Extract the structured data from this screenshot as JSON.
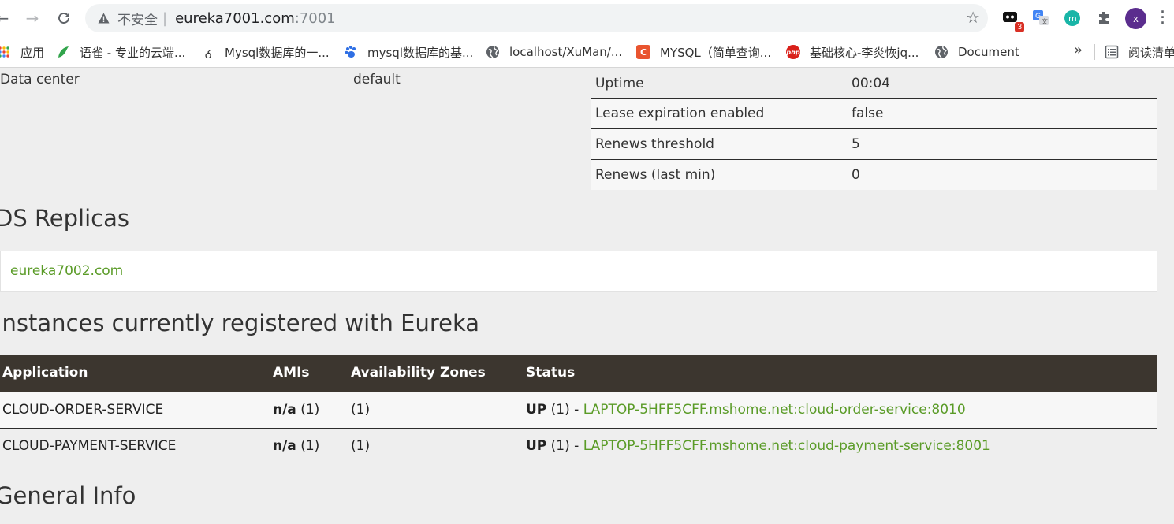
{
  "browser": {
    "insecure_label": "不安全",
    "url_host": "eureka7001.com",
    "url_port": ":7001",
    "extension_badge": "3",
    "profile_initial": "x",
    "bookmarks": [
      {
        "label": "应用",
        "icon": "apps-grid-icon"
      },
      {
        "label": "语雀 - 专业的云端...",
        "icon": "yuque-bird-icon",
        "color": "#31a44b"
      },
      {
        "label": "Mysql数据库的一...",
        "icon": "script-icon"
      },
      {
        "label": "mysql数据库的基...",
        "icon": "baidu-paw-icon",
        "color": "#2f6fe4"
      },
      {
        "label": "localhost/XuMan/...",
        "icon": "globe-icon"
      },
      {
        "label": "MYSQL（简单查询...",
        "icon": "csdn-c-icon",
        "color": "#e9542f"
      },
      {
        "label": "基础核心-李炎恢jq...",
        "icon": "php-icon",
        "color": "#d9201a"
      },
      {
        "label": "Document",
        "icon": "globe-icon"
      }
    ],
    "more_label": "»",
    "reading_list_label": "阅读清单"
  },
  "info": {
    "left_label": "Data center",
    "left_value": "default",
    "status_rows": [
      {
        "key": "Uptime",
        "value": "00:04"
      },
      {
        "key": "Lease expiration enabled",
        "value": "false"
      },
      {
        "key": "Renews threshold",
        "value": "5"
      },
      {
        "key": "Renews (last min)",
        "value": "0"
      }
    ]
  },
  "replicas": {
    "heading": "DS Replicas",
    "items": [
      "eureka7002.com"
    ]
  },
  "instances": {
    "heading": "Instances currently registered with Eureka",
    "columns": [
      "Application",
      "AMIs",
      "Availability Zones",
      "Status"
    ],
    "rows": [
      {
        "application": "CLOUD-ORDER-SERVICE",
        "amis_bold": "n/a",
        "amis_count": " (1)",
        "zones": "(1)",
        "status_prefix": "UP",
        "status_count": " (1) - ",
        "instance_link": "LAPTOP-5HFF5CFF.mshome.net:cloud-order-service:8010"
      },
      {
        "application": "CLOUD-PAYMENT-SERVICE",
        "amis_bold": "n/a",
        "amis_count": " (1)",
        "zones": "(1)",
        "status_prefix": "UP",
        "status_count": " (1) - ",
        "instance_link": "LAPTOP-5HFF5CFF.mshome.net:cloud-payment-service:8001"
      }
    ]
  },
  "general_info": {
    "heading": "General Info"
  },
  "colors": {
    "link_green": "#5a9b27",
    "table_header_bg": "#3c362f"
  }
}
